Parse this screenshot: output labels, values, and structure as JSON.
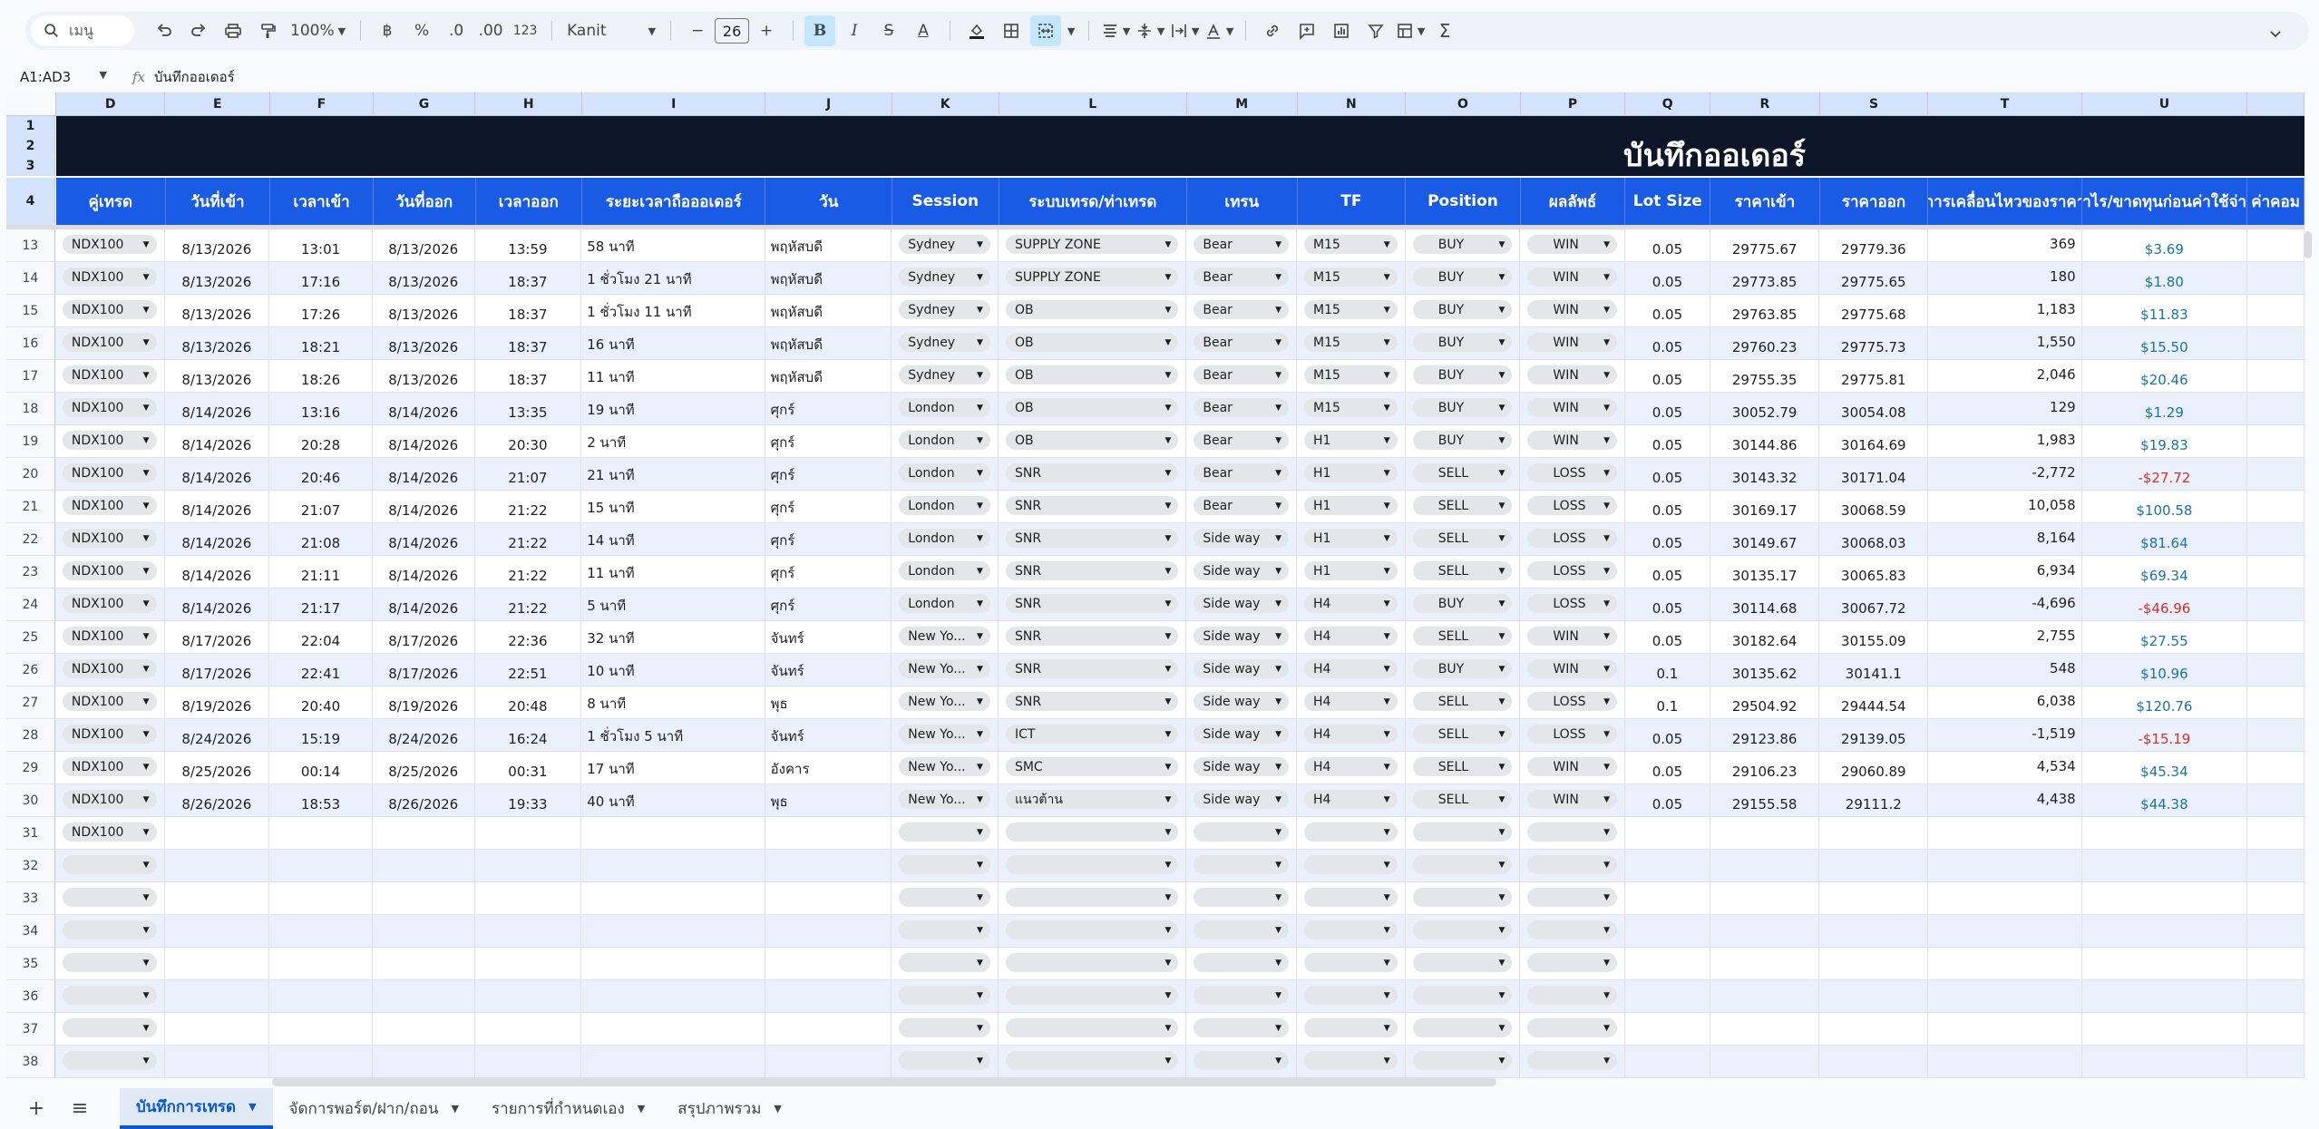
{
  "toolbar": {
    "search_label": "เมนู",
    "zoom": "100%",
    "format_currency": "฿",
    "format_percent": "%",
    "dec_less": ".0",
    "dec_more": ".00",
    "format_more": "123",
    "font": "Kanit",
    "font_size": "26"
  },
  "formula": {
    "namebox": "A1:AD3",
    "fx": "fx",
    "content": "บันทึกออเดอร์"
  },
  "columns": [
    "D",
    "E",
    "F",
    "G",
    "H",
    "I",
    "J",
    "K",
    "L",
    "M",
    "N",
    "O",
    "P",
    "Q",
    "R",
    "S",
    "T",
    "U",
    ""
  ],
  "row_headers_top": [
    "1",
    "2",
    "3",
    "4"
  ],
  "title": "บันทึกออเดอร์",
  "headers": [
    "คู่เทรด",
    "วันที่เข้า",
    "เวลาเข้า",
    "วันที่ออก",
    "เวลาออก",
    "ระยะเวลาถือออเดอร์",
    "วัน",
    "Session",
    "ระบบเทรด/ท่าเทรด",
    "เทรน",
    "TF",
    "Position",
    "ผลลัพธ์",
    "Lot Size",
    "ราคาเข้า",
    "ราคาออก",
    "การเคลื่อนไหวของราคา",
    "กำไร/ขาดทุนก่อนค่าใช้จ่าย",
    "ค่าคอม"
  ],
  "rows": [
    {
      "n": "13",
      "pair": "NDX100",
      "d_in": "8/13/2026",
      "t_in": "13:01",
      "d_out": "8/13/2026",
      "t_out": "13:59",
      "dur": "58 นาที",
      "day": "พฤหัสบดี",
      "session": "Sydney",
      "system": "SUPPLY ZONE",
      "trend": "Bear",
      "tf": "M15",
      "pos": "BUY",
      "result": "WIN",
      "lot": "0.05",
      "p_in": "29775.67",
      "p_out": "29779.36",
      "move": "369",
      "pnl": "$3.69",
      "neg": false
    },
    {
      "n": "14",
      "pair": "NDX100",
      "d_in": "8/13/2026",
      "t_in": "17:16",
      "d_out": "8/13/2026",
      "t_out": "18:37",
      "dur": "1 ชั่วโมง 21 นาที",
      "day": "พฤหัสบดี",
      "session": "Sydney",
      "system": "SUPPLY ZONE",
      "trend": "Bear",
      "tf": "M15",
      "pos": "BUY",
      "result": "WIN",
      "lot": "0.05",
      "p_in": "29773.85",
      "p_out": "29775.65",
      "move": "180",
      "pnl": "$1.80",
      "neg": false
    },
    {
      "n": "15",
      "pair": "NDX100",
      "d_in": "8/13/2026",
      "t_in": "17:26",
      "d_out": "8/13/2026",
      "t_out": "18:37",
      "dur": "1 ชั่วโมง 11 นาที",
      "day": "พฤหัสบดี",
      "session": "Sydney",
      "system": "OB",
      "trend": "Bear",
      "tf": "M15",
      "pos": "BUY",
      "result": "WIN",
      "lot": "0.05",
      "p_in": "29763.85",
      "p_out": "29775.68",
      "move": "1,183",
      "pnl": "$11.83",
      "neg": false
    },
    {
      "n": "16",
      "pair": "NDX100",
      "d_in": "8/13/2026",
      "t_in": "18:21",
      "d_out": "8/13/2026",
      "t_out": "18:37",
      "dur": "16 นาที",
      "day": "พฤหัสบดี",
      "session": "Sydney",
      "system": "OB",
      "trend": "Bear",
      "tf": "M15",
      "pos": "BUY",
      "result": "WIN",
      "lot": "0.05",
      "p_in": "29760.23",
      "p_out": "29775.73",
      "move": "1,550",
      "pnl": "$15.50",
      "neg": false
    },
    {
      "n": "17",
      "pair": "NDX100",
      "d_in": "8/13/2026",
      "t_in": "18:26",
      "d_out": "8/13/2026",
      "t_out": "18:37",
      "dur": "11 นาที",
      "day": "พฤหัสบดี",
      "session": "Sydney",
      "system": "OB",
      "trend": "Bear",
      "tf": "M15",
      "pos": "BUY",
      "result": "WIN",
      "lot": "0.05",
      "p_in": "29755.35",
      "p_out": "29775.81",
      "move": "2,046",
      "pnl": "$20.46",
      "neg": false
    },
    {
      "n": "18",
      "pair": "NDX100",
      "d_in": "8/14/2026",
      "t_in": "13:16",
      "d_out": "8/14/2026",
      "t_out": "13:35",
      "dur": "19 นาที",
      "day": "ศุกร์",
      "session": "London",
      "system": "OB",
      "trend": "Bear",
      "tf": "M15",
      "pos": "BUY",
      "result": "WIN",
      "lot": "0.05",
      "p_in": "30052.79",
      "p_out": "30054.08",
      "move": "129",
      "pnl": "$1.29",
      "neg": false
    },
    {
      "n": "19",
      "pair": "NDX100",
      "d_in": "8/14/2026",
      "t_in": "20:28",
      "d_out": "8/14/2026",
      "t_out": "20:30",
      "dur": "2 นาที",
      "day": "ศุกร์",
      "session": "London",
      "system": "OB",
      "trend": "Bear",
      "tf": "H1",
      "pos": "BUY",
      "result": "WIN",
      "lot": "0.05",
      "p_in": "30144.86",
      "p_out": "30164.69",
      "move": "1,983",
      "pnl": "$19.83",
      "neg": false
    },
    {
      "n": "20",
      "pair": "NDX100",
      "d_in": "8/14/2026",
      "t_in": "20:46",
      "d_out": "8/14/2026",
      "t_out": "21:07",
      "dur": "21 นาที",
      "day": "ศุกร์",
      "session": "London",
      "system": "SNR",
      "trend": "Bear",
      "tf": "H1",
      "pos": "SELL",
      "result": "LOSS",
      "lot": "0.05",
      "p_in": "30143.32",
      "p_out": "30171.04",
      "move": "-2,772",
      "pnl": "-$27.72",
      "neg": true
    },
    {
      "n": "21",
      "pair": "NDX100",
      "d_in": "8/14/2026",
      "t_in": "21:07",
      "d_out": "8/14/2026",
      "t_out": "21:22",
      "dur": "15 นาที",
      "day": "ศุกร์",
      "session": "London",
      "system": "SNR",
      "trend": "Bear",
      "tf": "H1",
      "pos": "SELL",
      "result": "LOSS",
      "lot": "0.05",
      "p_in": "30169.17",
      "p_out": "30068.59",
      "move": "10,058",
      "pnl": "$100.58",
      "neg": false
    },
    {
      "n": "22",
      "pair": "NDX100",
      "d_in": "8/14/2026",
      "t_in": "21:08",
      "d_out": "8/14/2026",
      "t_out": "21:22",
      "dur": "14 นาที",
      "day": "ศุกร์",
      "session": "London",
      "system": "SNR",
      "trend": "Side way",
      "tf": "H1",
      "pos": "SELL",
      "result": "LOSS",
      "lot": "0.05",
      "p_in": "30149.67",
      "p_out": "30068.03",
      "move": "8,164",
      "pnl": "$81.64",
      "neg": false
    },
    {
      "n": "23",
      "pair": "NDX100",
      "d_in": "8/14/2026",
      "t_in": "21:11",
      "d_out": "8/14/2026",
      "t_out": "21:22",
      "dur": "11 นาที",
      "day": "ศุกร์",
      "session": "London",
      "system": "SNR",
      "trend": "Side way",
      "tf": "H1",
      "pos": "SELL",
      "result": "LOSS",
      "lot": "0.05",
      "p_in": "30135.17",
      "p_out": "30065.83",
      "move": "6,934",
      "pnl": "$69.34",
      "neg": false
    },
    {
      "n": "24",
      "pair": "NDX100",
      "d_in": "8/14/2026",
      "t_in": "21:17",
      "d_out": "8/14/2026",
      "t_out": "21:22",
      "dur": "5 นาที",
      "day": "ศุกร์",
      "session": "London",
      "system": "SNR",
      "trend": "Side way",
      "tf": "H4",
      "pos": "BUY",
      "result": "LOSS",
      "lot": "0.05",
      "p_in": "30114.68",
      "p_out": "30067.72",
      "move": "-4,696",
      "pnl": "-$46.96",
      "neg": true
    },
    {
      "n": "25",
      "pair": "NDX100",
      "d_in": "8/17/2026",
      "t_in": "22:04",
      "d_out": "8/17/2026",
      "t_out": "22:36",
      "dur": "32 นาที",
      "day": "จันทร์",
      "session": "New Yo...",
      "system": "SNR",
      "trend": "Side way",
      "tf": "H4",
      "pos": "SELL",
      "result": "WIN",
      "lot": "0.05",
      "p_in": "30182.64",
      "p_out": "30155.09",
      "move": "2,755",
      "pnl": "$27.55",
      "neg": false
    },
    {
      "n": "26",
      "pair": "NDX100",
      "d_in": "8/17/2026",
      "t_in": "22:41",
      "d_out": "8/17/2026",
      "t_out": "22:51",
      "dur": "10 นาที",
      "day": "จันทร์",
      "session": "New Yo...",
      "system": "SNR",
      "trend": "Side way",
      "tf": "H4",
      "pos": "BUY",
      "result": "WIN",
      "lot": "0.1",
      "p_in": "30135.62",
      "p_out": "30141.1",
      "move": "548",
      "pnl": "$10.96",
      "neg": false
    },
    {
      "n": "27",
      "pair": "NDX100",
      "d_in": "8/19/2026",
      "t_in": "20:40",
      "d_out": "8/19/2026",
      "t_out": "20:48",
      "dur": "8 นาที",
      "day": "พุธ",
      "session": "New Yo...",
      "system": "SNR",
      "trend": "Side way",
      "tf": "H4",
      "pos": "SELL",
      "result": "LOSS",
      "lot": "0.1",
      "p_in": "29504.92",
      "p_out": "29444.54",
      "move": "6,038",
      "pnl": "$120.76",
      "neg": false
    },
    {
      "n": "28",
      "pair": "NDX100",
      "d_in": "8/24/2026",
      "t_in": "15:19",
      "d_out": "8/24/2026",
      "t_out": "16:24",
      "dur": "1 ชั่วโมง 5 นาที",
      "day": "จันทร์",
      "session": "New Yo...",
      "system": "ICT",
      "trend": "Side way",
      "tf": "H4",
      "pos": "SELL",
      "result": "LOSS",
      "lot": "0.05",
      "p_in": "29123.86",
      "p_out": "29139.05",
      "move": "-1,519",
      "pnl": "-$15.19",
      "neg": true
    },
    {
      "n": "29",
      "pair": "NDX100",
      "d_in": "8/25/2026",
      "t_in": "00:14",
      "d_out": "8/25/2026",
      "t_out": "00:31",
      "dur": "17 นาที",
      "day": "อังคาร",
      "session": "New Yo...",
      "system": "SMC",
      "trend": "Side way",
      "tf": "H4",
      "pos": "SELL",
      "result": "WIN",
      "lot": "0.05",
      "p_in": "29106.23",
      "p_out": "29060.89",
      "move": "4,534",
      "pnl": "$45.34",
      "neg": false
    },
    {
      "n": "30",
      "pair": "NDX100",
      "d_in": "8/26/2026",
      "t_in": "18:53",
      "d_out": "8/26/2026",
      "t_out": "19:33",
      "dur": "40 นาที",
      "day": "พุธ",
      "session": "New Yo...",
      "system": "แนวต้าน",
      "trend": "Side way",
      "tf": "H4",
      "pos": "SELL",
      "result": "WIN",
      "lot": "0.05",
      "p_in": "29155.58",
      "p_out": "29111.2",
      "move": "4,438",
      "pnl": "$44.38",
      "neg": false
    }
  ],
  "empty_rows": [
    {
      "n": "31",
      "pair": "NDX100"
    },
    {
      "n": "32",
      "pair": ""
    },
    {
      "n": "33",
      "pair": ""
    },
    {
      "n": "34",
      "pair": ""
    },
    {
      "n": "35",
      "pair": ""
    },
    {
      "n": "36",
      "pair": ""
    },
    {
      "n": "37",
      "pair": ""
    },
    {
      "n": "38",
      "pair": ""
    }
  ],
  "sheets": [
    "บันทึกการเทรด",
    "จัดการพอร์ต/ฝาก/ถอน",
    "รายการที่กำหนดเอง",
    "สรุปภาพรวม"
  ],
  "colors": {
    "header_blue": "#1a5be6",
    "title_bg": "#0d1629",
    "alt_row": "#eaf1fd",
    "profit": "#1a73a8",
    "loss": "#d93025"
  }
}
